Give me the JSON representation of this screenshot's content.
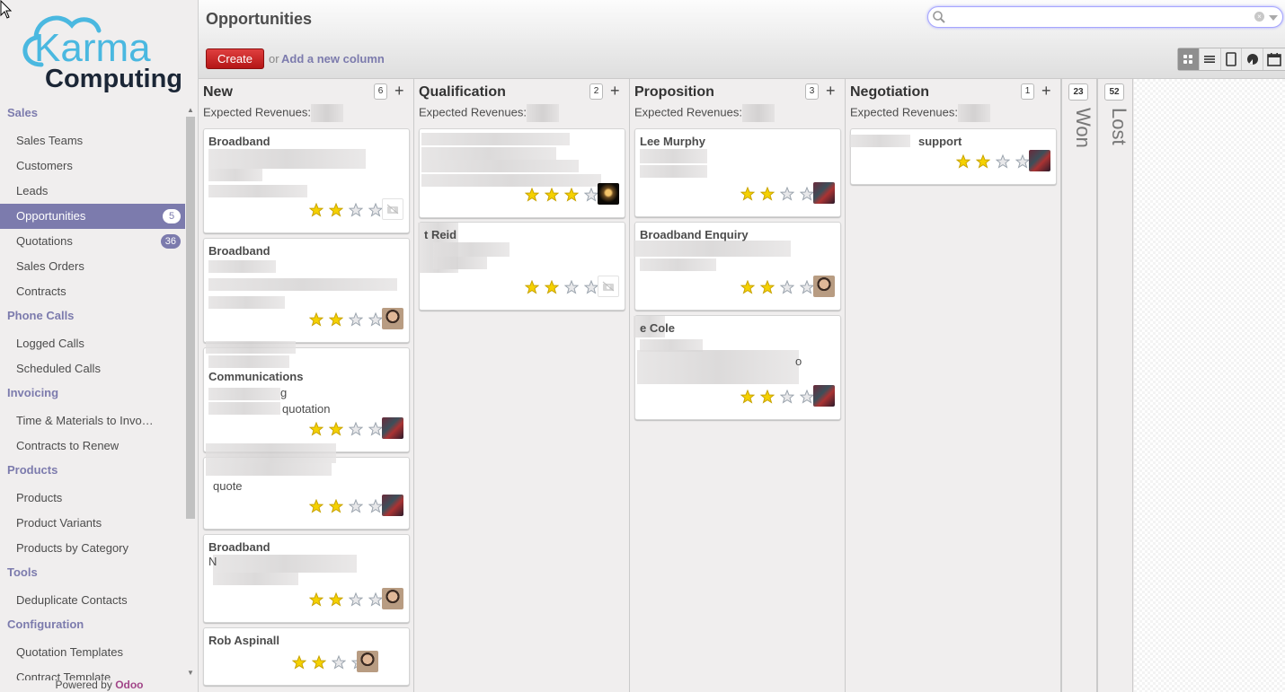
{
  "brand": {
    "line1": "Karma",
    "line2": "Computing",
    "powered_prefix": "Powered by ",
    "powered_name": "Odoo"
  },
  "sidebar": {
    "sections": [
      {
        "label": "Sales",
        "items": [
          {
            "label": "Sales Teams"
          },
          {
            "label": "Customers"
          },
          {
            "label": "Leads"
          },
          {
            "label": "Opportunities",
            "badge": "5",
            "active": true
          },
          {
            "label": "Quotations",
            "badge": "36"
          },
          {
            "label": "Sales Orders"
          },
          {
            "label": "Contracts"
          }
        ]
      },
      {
        "label": "Phone Calls",
        "items": [
          {
            "label": "Logged Calls"
          },
          {
            "label": "Scheduled Calls"
          }
        ]
      },
      {
        "label": "Invoicing",
        "items": [
          {
            "label": "Time & Materials to Invo…"
          },
          {
            "label": "Contracts to Renew"
          }
        ]
      },
      {
        "label": "Products",
        "items": [
          {
            "label": "Products"
          },
          {
            "label": "Product Variants"
          },
          {
            "label": "Products by Category"
          }
        ]
      },
      {
        "label": "Tools",
        "items": [
          {
            "label": "Deduplicate Contacts"
          }
        ]
      },
      {
        "label": "Configuration",
        "items": [
          {
            "label": "Quotation Templates"
          },
          {
            "label": "Contract Template"
          }
        ]
      }
    ]
  },
  "header": {
    "title": "Opportunities",
    "search": {
      "value": "",
      "placeholder": ""
    },
    "create_label": "Create",
    "or_label": "or",
    "add_column_label": "Add a new column",
    "views": [
      {
        "name": "kanban",
        "icon": "kanban-icon",
        "active": true
      },
      {
        "name": "list",
        "icon": "list-icon"
      },
      {
        "name": "form",
        "icon": "form-icon"
      },
      {
        "name": "graph",
        "icon": "graph-icon"
      },
      {
        "name": "calendar",
        "icon": "calendar-icon"
      }
    ]
  },
  "kanban": {
    "revenue_label": "Expected Revenues:",
    "columns": [
      {
        "title": "New",
        "count": "6",
        "cards": [
          {
            "title": "Broadband",
            "text": [],
            "rating": 2,
            "avatar": "none"
          },
          {
            "title": "Broadband",
            "text": [],
            "rating": 2,
            "avatar": "man"
          },
          {
            "title": "Communications",
            "text": [
              "g",
              "quotation"
            ],
            "rating": 2,
            "avatar": "mix"
          },
          {
            "title": "",
            "text": [
              "quote"
            ],
            "rating": 2,
            "avatar": "mix"
          },
          {
            "title": "Broadband",
            "text": [
              "N"
            ],
            "rating": 2,
            "avatar": "man"
          },
          {
            "title": "Rob Aspinall",
            "text": [],
            "rating": 2,
            "avatar": "man"
          }
        ]
      },
      {
        "title": "Qualification",
        "count": "2",
        "cards": [
          {
            "title": "",
            "text": [],
            "rating": 3,
            "avatar": "bulb"
          },
          {
            "title": "t Reid",
            "text": [],
            "rating": 2,
            "avatar": "none"
          }
        ]
      },
      {
        "title": "Proposition",
        "count": "3",
        "cards": [
          {
            "title": "Lee Murphy",
            "text": [],
            "rating": 2,
            "avatar": "mix"
          },
          {
            "title": "Broadband Enquiry",
            "text": [],
            "rating": 2,
            "avatar": "man"
          },
          {
            "title": "e Cole",
            "text": [
              "o"
            ],
            "rating": 2,
            "avatar": "mix"
          }
        ]
      },
      {
        "title": "Negotiation",
        "count": "1",
        "cards": [
          {
            "title": "support",
            "text": [],
            "rating": 2,
            "avatar": "mix"
          }
        ]
      }
    ],
    "folded": [
      {
        "title": "Won",
        "count": "23"
      },
      {
        "title": "Lost",
        "count": "52"
      }
    ],
    "max_rating": 4
  }
}
